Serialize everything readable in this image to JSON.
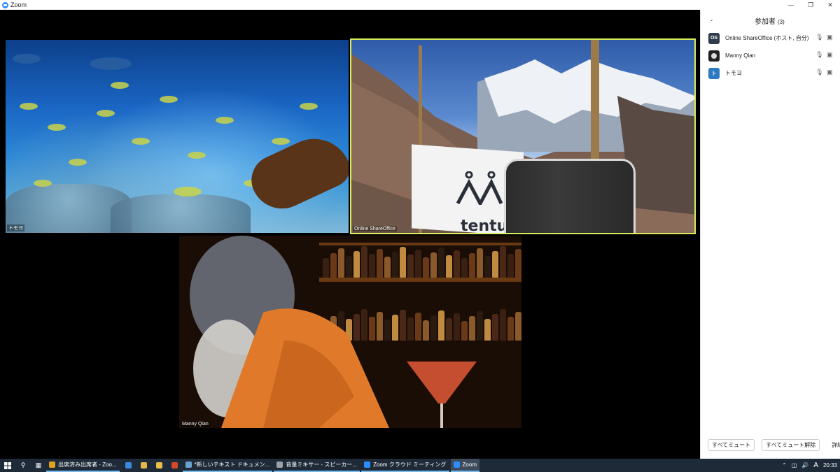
{
  "window": {
    "title": "Zoom"
  },
  "tiles": [
    {
      "name": "トモヨ"
    },
    {
      "name": "Online ShareOffice",
      "flag_text": "tentu"
    },
    {
      "name": "Manny Qian"
    }
  ],
  "participants_panel": {
    "title": "参加者",
    "count": "(3)",
    "participants": [
      {
        "initials": "OS",
        "name": "Online ShareOffice (ホスト, 自分)",
        "color": "#2f3b4a"
      },
      {
        "initials": "",
        "name": "Manny Qian",
        "color": "#222222"
      },
      {
        "initials": "ト",
        "name": "トモヨ",
        "color": "#2d7ac0"
      }
    ],
    "footer": {
      "mute_all": "すべてミュート",
      "unmute_all": "すべてミュート解除",
      "more": "詳細"
    }
  },
  "taskbar": {
    "apps": [
      {
        "label": "出席済み出席者 - Zoo...",
        "color": "#e0a020"
      },
      {
        "label": "*新しいテキスト ドキュメン...",
        "color": "#6aa0d0"
      },
      {
        "label": "音量ミキサー - スピーカー...",
        "color": "#9aa0a8"
      },
      {
        "label": "Zoom クラウド ミーティング",
        "color": "#2d8cff"
      },
      {
        "label": "Zoom",
        "color": "#2d8cff"
      }
    ],
    "ime": "A",
    "time": "20:33"
  },
  "colors": {
    "active_speaker_border": "#d8ec5a",
    "zoom_blue": "#2d8cff"
  }
}
